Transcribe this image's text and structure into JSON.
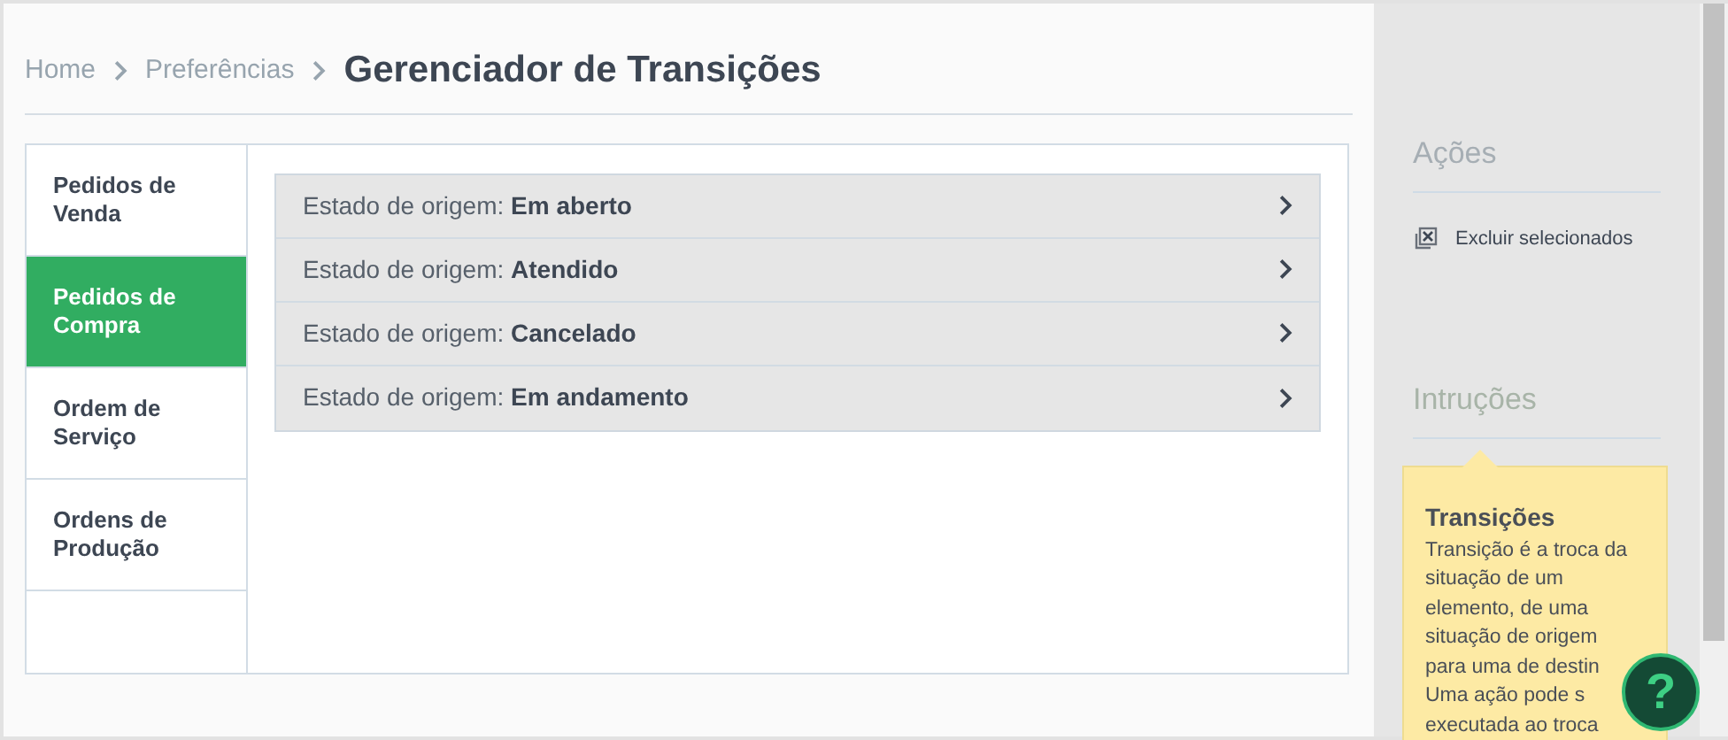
{
  "breadcrumb": {
    "items": [
      "Home",
      "Preferências"
    ],
    "current": "Gerenciador de Transições"
  },
  "tabs": [
    {
      "label": "Pedidos de Venda",
      "selected": false
    },
    {
      "label": "Pedidos de Compra",
      "selected": true
    },
    {
      "label": "Ordem de Serviço",
      "selected": false
    },
    {
      "label": "Ordens de Produção",
      "selected": false
    }
  ],
  "transitions": [
    {
      "prefix": "Estado de origem:",
      "state": "Em aberto"
    },
    {
      "prefix": "Estado de origem:",
      "state": "Atendido"
    },
    {
      "prefix": "Estado de origem:",
      "state": "Cancelado"
    },
    {
      "prefix": "Estado de origem:",
      "state": "Em andamento"
    }
  ],
  "sidebar": {
    "actions_title": "Ações",
    "actions": [
      "Excluir selecionados"
    ],
    "instructions_title": "Intruções",
    "note": {
      "title": "Transições",
      "lines": [
        "Transição é a troca da",
        "situação de um",
        "elemento, de uma",
        "situação de origem",
        "para uma de destin",
        "Uma ação pode s",
        "executada ao troca"
      ]
    }
  },
  "help_button": {
    "label": "?"
  }
}
